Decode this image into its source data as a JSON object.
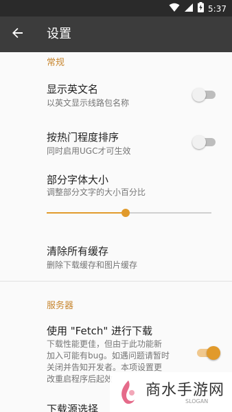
{
  "status_bar": {
    "time": "5:37",
    "icons": [
      "wifi-icon",
      "signal-icon",
      "battery-charging-icon"
    ]
  },
  "app_bar": {
    "title": "设置",
    "back_icon": "arrow-back-icon"
  },
  "sections": {
    "general": {
      "header": "常规",
      "show_english_name": {
        "title": "显示英文名",
        "subtitle": "以英文显示线路包名称",
        "enabled": false
      },
      "sort_by_popularity": {
        "title": "按热门程度排序",
        "subtitle": "同时启用UGC才可生效",
        "enabled": false
      },
      "font_size": {
        "title": "部分字体大小",
        "subtitle": "调整部分文字的大小百分比",
        "value": 0.48
      },
      "clear_cache": {
        "title": "清除所有缓存",
        "subtitle": "删除下载缓存和图片缓存"
      }
    },
    "server": {
      "header": "服务器",
      "fetch_download": {
        "title": "使用 \"Fetch\" 进行下载",
        "subtitle_lines": [
          "下载性能更佳，但由于此功能新",
          "加入可能有bug。如遇问题请暂时",
          "关闭并告知开发者。本项设置更",
          "改重启程序后起效"
        ],
        "enabled": true
      },
      "download_source": {
        "title": "下载源选择"
      }
    }
  },
  "watermark": {
    "text": "商水手游网",
    "sub": "SLOGAN"
  },
  "colors": {
    "accent": "#e19a2b",
    "header_text": "#c7862f",
    "app_bar": "#3c3c3c",
    "status_bar": "#2a2a2a"
  }
}
